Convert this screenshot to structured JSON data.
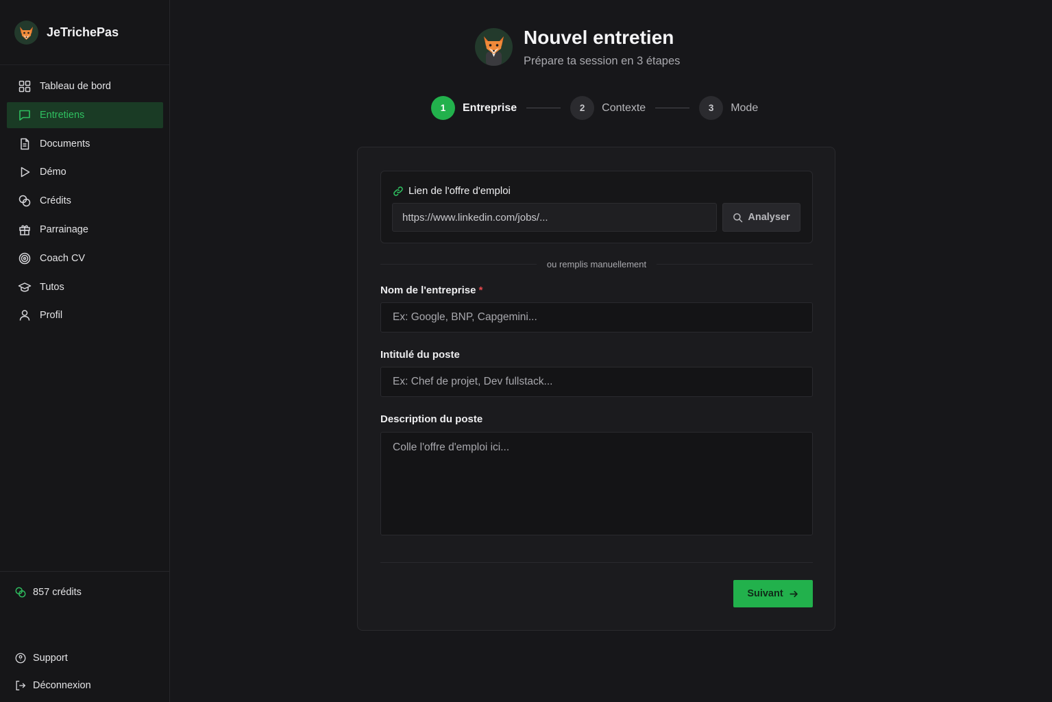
{
  "brand": {
    "name": "JeTrichePas"
  },
  "sidebar": {
    "items": [
      {
        "label": "Tableau de bord",
        "icon": "dashboard-grid-icon",
        "active": false
      },
      {
        "label": "Entretiens",
        "icon": "chat-bubble-icon",
        "active": true
      },
      {
        "label": "Documents",
        "icon": "document-icon",
        "active": false
      },
      {
        "label": "Démo",
        "icon": "play-icon",
        "active": false
      },
      {
        "label": "Crédits",
        "icon": "coins-icon",
        "active": false
      },
      {
        "label": "Parrainage",
        "icon": "gift-icon",
        "active": false
      },
      {
        "label": "Coach CV",
        "icon": "target-icon",
        "active": false
      },
      {
        "label": "Tutos",
        "icon": "graduation-cap-icon",
        "active": false
      },
      {
        "label": "Profil",
        "icon": "user-icon",
        "active": false
      }
    ],
    "credits": "857 crédits",
    "support": "Support",
    "logout": "Déconnexion"
  },
  "header": {
    "title": "Nouvel entretien",
    "subtitle": "Prépare ta session en 3 étapes"
  },
  "stepper": {
    "steps": [
      {
        "number": "1",
        "label": "Entreprise",
        "state": "current"
      },
      {
        "number": "2",
        "label": "Contexte",
        "state": "upcoming"
      },
      {
        "number": "3",
        "label": "Mode",
        "state": "upcoming"
      }
    ]
  },
  "form": {
    "link_section": {
      "label": "Lien de l'offre d'emploi",
      "url_value": "https://www.linkedin.com/jobs/...",
      "analyze_label": "Analyser"
    },
    "or_text": "ou remplis manuellement",
    "company": {
      "label": "Nom de l'entreprise",
      "required_mark": "*",
      "placeholder": "Ex: Google, BNP, Capgemini..."
    },
    "position": {
      "label": "Intitulé du poste",
      "placeholder": "Ex: Chef de projet, Dev fullstack..."
    },
    "description": {
      "label": "Description du poste",
      "placeholder": "Colle l'offre d'emploi ici..."
    },
    "next_label": "Suivant"
  },
  "colors": {
    "accent": "#22b14c",
    "active_nav_bg": "#1a3b25",
    "background": "#17171a",
    "required": "#e5484d"
  }
}
